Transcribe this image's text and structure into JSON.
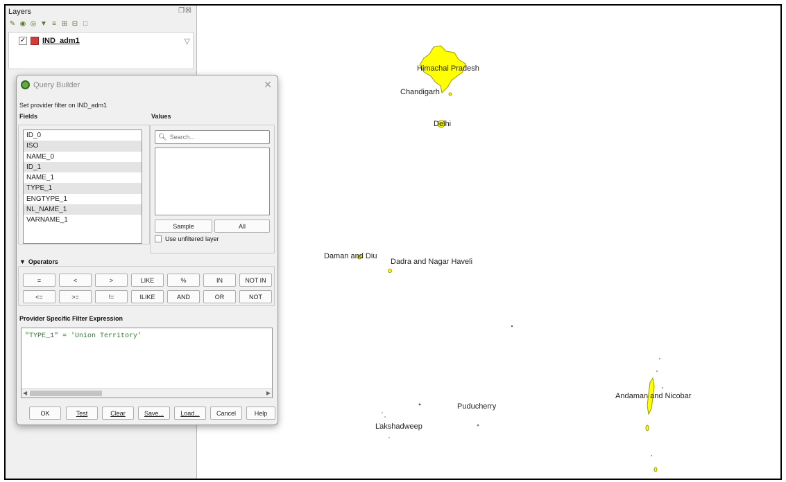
{
  "layers_panel": {
    "title": "Layers",
    "window_controls": "❐☒",
    "toolbar_icons": [
      "open-layer-styling-icon",
      "add-group-icon",
      "manage-visibility-icon",
      "filter-legend-icon",
      "filter-expression-icon",
      "expand-all-icon",
      "collapse-all-icon",
      "remove-layer-icon"
    ],
    "layer": {
      "checked": "✓",
      "name": "IND_adm1",
      "color": "#d43b3b"
    }
  },
  "map": {
    "feature_color": "#ffff00",
    "labels": {
      "himachal": "Himachal Pradesh",
      "chandigarh": "Chandigarh",
      "delhi": "Delhi",
      "daman": "Daman and Diu",
      "dadra": "Dadra and Nagar Haveli",
      "puducherry": "Puducherry",
      "lakshadweep": "Lakshadweep",
      "andaman": "Andaman and Nicobar"
    }
  },
  "dialog": {
    "title": "Query Builder",
    "close": "✕",
    "subtitle": "Set provider filter on IND_adm1",
    "fields_label": "Fields",
    "values_label": "Values",
    "fields": [
      "ID_0",
      "ISO",
      "NAME_0",
      "ID_1",
      "NAME_1",
      "TYPE_1",
      "ENGTYPE_1",
      "NL_NAME_1",
      "VARNAME_1"
    ],
    "search_placeholder": "Search...",
    "sample_button": "Sample",
    "all_button": "All",
    "use_unfiltered": "Use unfiltered layer",
    "operators_label": "Operators",
    "operators_row1": [
      "=",
      "<",
      ">",
      "LIKE",
      "%",
      "IN",
      "NOT IN"
    ],
    "operators_row2": [
      "<=",
      ">=",
      "!=",
      "ILIKE",
      "AND",
      "OR",
      "NOT"
    ],
    "expression_label": "Provider Specific Filter Expression",
    "expression": "\"TYPE_1\" = 'Union Territory'",
    "buttons": {
      "ok": "OK",
      "test": "Test",
      "clear": "Clear",
      "save": "Save...",
      "load": "Load...",
      "cancel": "Cancel",
      "help": "Help"
    }
  }
}
